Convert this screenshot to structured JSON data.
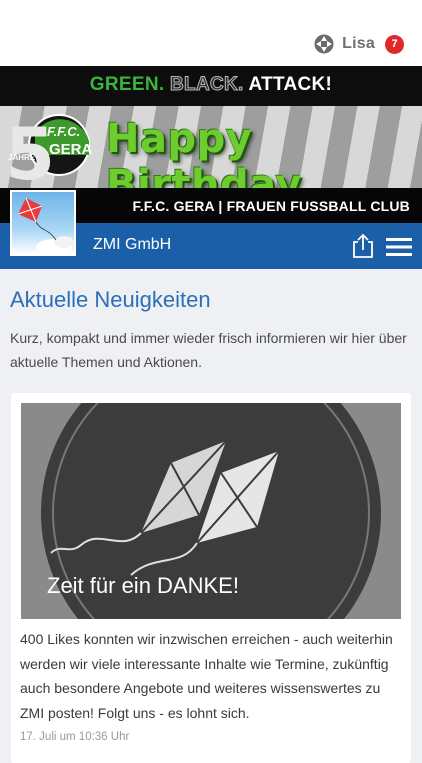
{
  "header": {
    "user_name": "Lisa",
    "notification_count": "7"
  },
  "banner": {
    "slogan_green": "GREEN.",
    "slogan_black": "BLACK.",
    "slogan_attack": "ATTACK!",
    "birthday": "Happy Birthday",
    "club": "F.F.C. GERA | FRAUEN FUSSBALL CLUB",
    "logo_number": "5",
    "logo_jahre": "JAHRE",
    "logo_ffc": "F.F.C.",
    "logo_gera": "GERA"
  },
  "nav": {
    "company": "ZMI GmbH"
  },
  "main": {
    "headline": "Aktuelle Neuigkeiten",
    "intro": "Kurz, kompakt und immer wieder frisch informieren wir hier über aktuelle Themen und Aktionen."
  },
  "post": {
    "image_title": "Zeit für ein DANKE!",
    "text": "400 Likes konnten wir inzwischen erreichen - auch weiterhin werden wir viele interessante Inhalte wie Termine, zukünftig auch besondere Angebote und weiteres wissenswertes zu ZMI posten! Folgt uns - es lohnt sich.",
    "date": "17. Juli um 10:36 Uhr"
  },
  "icons": {
    "user": "user-icon",
    "share": "share-icon",
    "menu": "menu-icon"
  },
  "colors": {
    "accent_blue": "#1a5fa8",
    "headline_blue": "#2a6fb8",
    "badge_red": "#e02828",
    "brand_green": "#6fcc2e"
  }
}
